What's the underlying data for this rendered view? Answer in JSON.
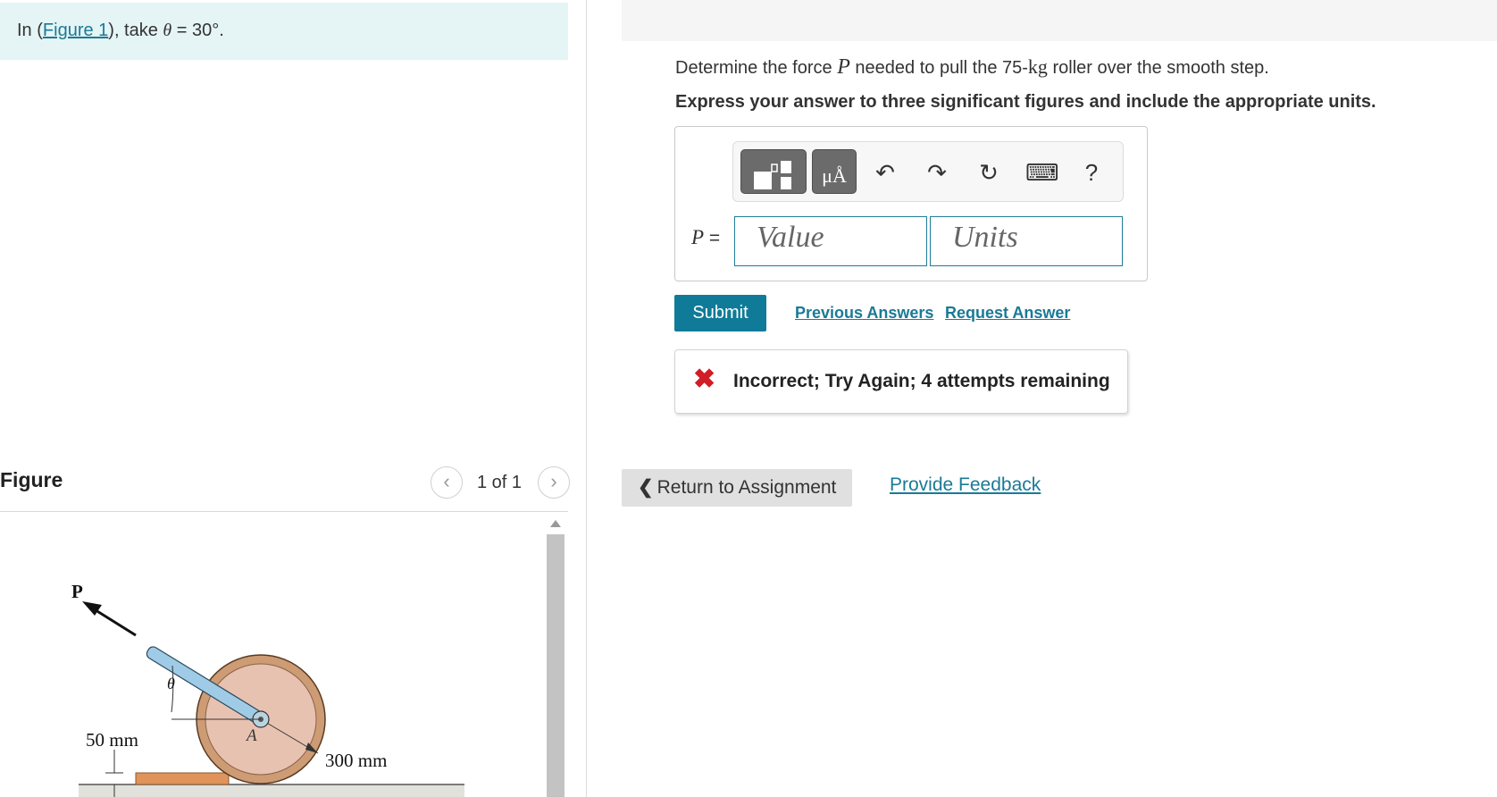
{
  "intro": {
    "prefix": "In (",
    "figure_link": "Figure 1",
    "middle": "), take ",
    "theta": "θ",
    "suffix": " = 30°."
  },
  "figure_panel": {
    "title": "Figure",
    "pager_prev": "‹",
    "pager_count": "1 of 1",
    "pager_next": "›",
    "labels": {
      "p": "P",
      "theta": "θ",
      "a": "A",
      "dim_50": "50 mm",
      "dim_300": "300 mm"
    }
  },
  "question": {
    "text_before": "Determine the force ",
    "var": "P",
    "text_middle": " needed to pull the 75-",
    "unit": "kg",
    "text_after": " roller over the smooth step.",
    "instruction": "Express your answer to three significant figures and include the appropriate units."
  },
  "toolbar": {
    "units_label": "μÅ",
    "undo": "↶",
    "redo": "↷",
    "reset": "↻",
    "keyboard": "⌨",
    "help": "?"
  },
  "answer": {
    "var": "P",
    "equals": " =",
    "value_placeholder": "Value",
    "units_placeholder": "Units"
  },
  "actions": {
    "submit": "Submit",
    "previous_answers": "Previous Answers",
    "request_answer": "Request Answer"
  },
  "feedback": {
    "icon": "✖",
    "message": "Incorrect; Try Again; 4 attempts remaining"
  },
  "footer": {
    "return_chevron": "❮",
    "return_label": "Return to Assignment",
    "provide_feedback": "Provide Feedback"
  },
  "colors": {
    "accent": "#0f7b98",
    "intro_bg": "#e5f4f5",
    "error": "#d11d27",
    "roller_outer": "#cd9c74",
    "roller_inner": "#e8c2b0",
    "rod": "#9fcbe6",
    "step": "#e0945a"
  }
}
